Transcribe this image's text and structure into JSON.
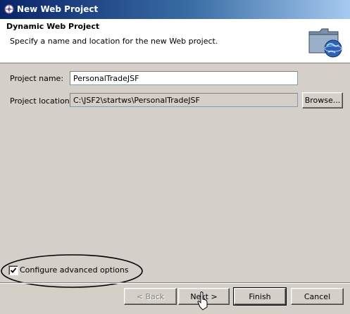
{
  "window": {
    "title": "New Web Project",
    "icon": "eclipse-icon"
  },
  "header": {
    "title": "Dynamic Web Project",
    "description": "Specify a name and location for the new Web project.",
    "banner_icon": "folder-globe-icon"
  },
  "form": {
    "project_name_label": "Project name:",
    "project_name_value": "PersonalTradeJSF",
    "project_location_label": "Project location:",
    "project_location_value": "C:\\JSF2\\startws\\PersonalTradeJSF",
    "browse_label": "Browse..."
  },
  "advanced": {
    "label": "Configure advanced options",
    "checked": true
  },
  "buttons": {
    "back": "< Back",
    "next": "Next >",
    "finish": "Finish",
    "cancel": "Cancel"
  },
  "colors": {
    "titlebar_start": "#0a246a",
    "titlebar_end": "#a6caf0",
    "dialog_bg": "#d4d0c8",
    "annotation": "#000000"
  }
}
